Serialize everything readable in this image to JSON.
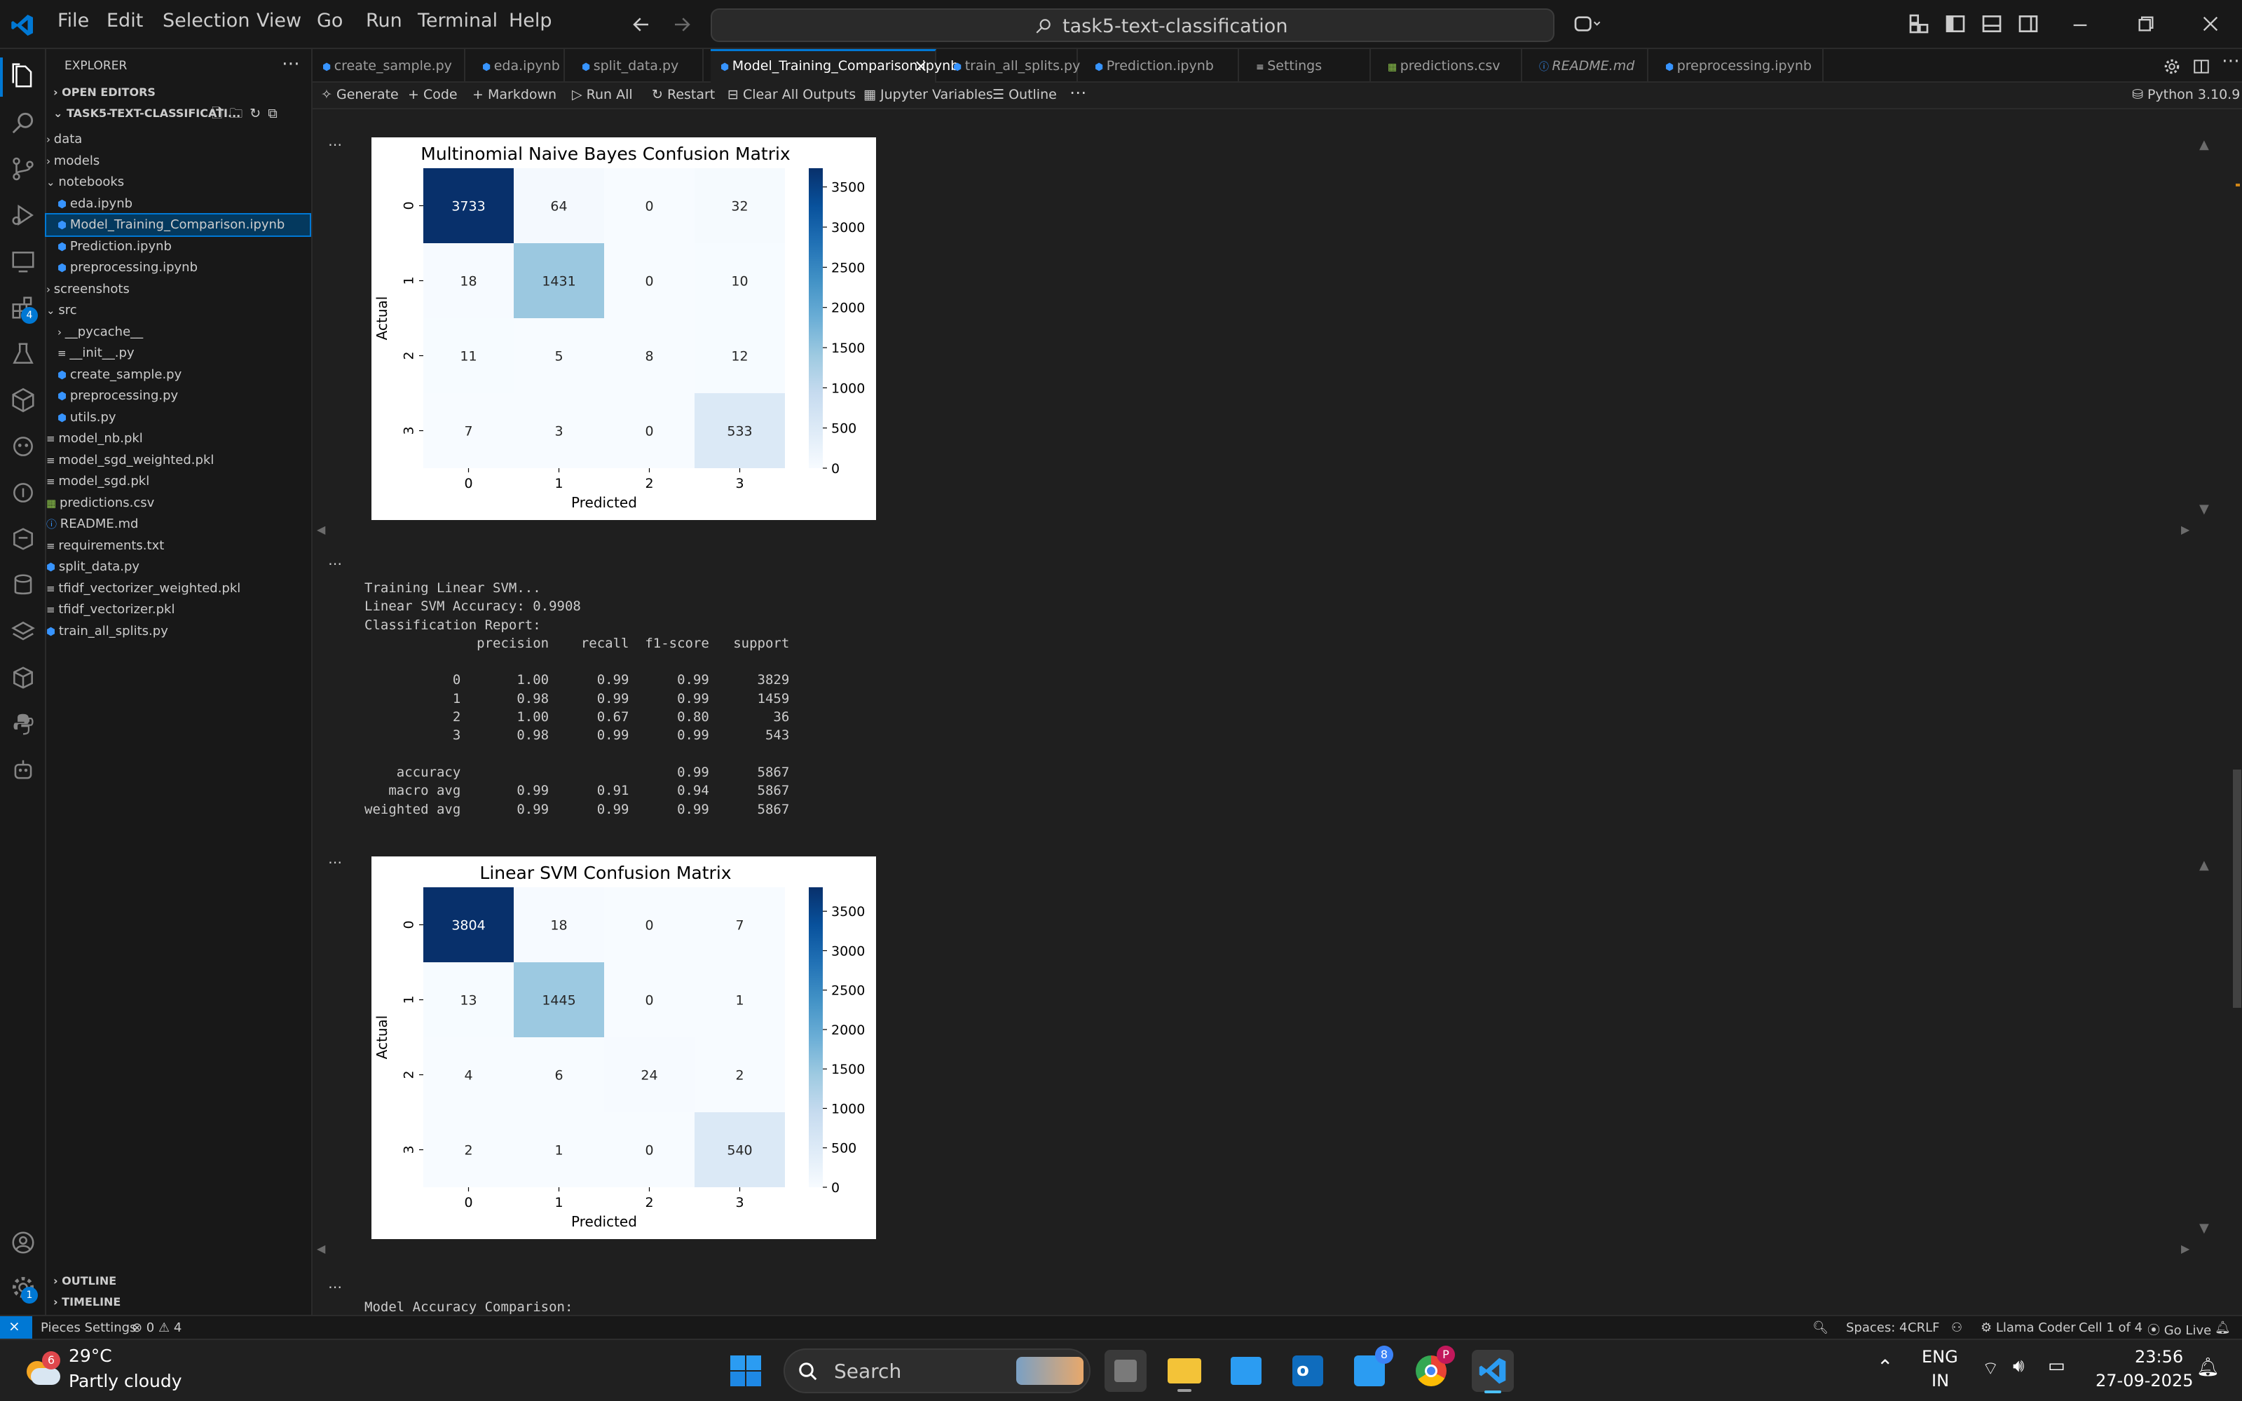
{
  "menu": [
    "File",
    "Edit",
    "Selection",
    "View",
    "Go",
    "Run",
    "Terminal",
    "Help"
  ],
  "command_center": "task5-text-classification",
  "explorer": {
    "title": "EXPLORER",
    "open_editors": "OPEN EDITORS",
    "project": "TASK5-TEXT-CLASSIFICATI...",
    "items": [
      {
        "label": "data",
        "kind": "folder"
      },
      {
        "label": "models",
        "kind": "folder"
      },
      {
        "label": "notebooks",
        "kind": "folder-open"
      },
      {
        "label": "eda.ipynb",
        "kind": "notebook"
      },
      {
        "label": "Model_Training_Comparison.ipynb",
        "kind": "notebook",
        "selected": true
      },
      {
        "label": "Prediction.ipynb",
        "kind": "notebook"
      },
      {
        "label": "preprocessing.ipynb",
        "kind": "notebook"
      },
      {
        "label": "screenshots",
        "kind": "folder"
      },
      {
        "label": "src",
        "kind": "folder-open"
      },
      {
        "label": "__pycache__",
        "kind": "folder"
      },
      {
        "label": "__init__.py",
        "kind": "file"
      },
      {
        "label": "create_sample.py",
        "kind": "python"
      },
      {
        "label": "preprocessing.py",
        "kind": "python"
      },
      {
        "label": "utils.py",
        "kind": "python"
      },
      {
        "label": "model_nb.pkl",
        "kind": "file"
      },
      {
        "label": "model_sgd_weighted.pkl",
        "kind": "file"
      },
      {
        "label": "model_sgd.pkl",
        "kind": "file"
      },
      {
        "label": "predictions.csv",
        "kind": "csv"
      },
      {
        "label": "README.md",
        "kind": "info"
      },
      {
        "label": "requirements.txt",
        "kind": "file"
      },
      {
        "label": "split_data.py",
        "kind": "python"
      },
      {
        "label": "tfidf_vectorizer_weighted.pkl",
        "kind": "file"
      },
      {
        "label": "tfidf_vectorizer.pkl",
        "kind": "file"
      },
      {
        "label": "train_all_splits.py",
        "kind": "python"
      }
    ],
    "outline": "OUTLINE",
    "timeline": "TIMELINE"
  },
  "tabs": [
    {
      "label": "create_sample.py",
      "active": false
    },
    {
      "label": "eda.ipynb",
      "active": false
    },
    {
      "label": "split_data.py",
      "active": false
    },
    {
      "label": "Model_Training_Comparison.ipynb",
      "active": true
    },
    {
      "label": "train_all_splits.py",
      "active": false
    },
    {
      "label": "Prediction.ipynb",
      "active": false
    },
    {
      "label": "Settings",
      "active": false
    },
    {
      "label": "predictions.csv",
      "active": false
    },
    {
      "label": "README.md",
      "active": false
    },
    {
      "label": "preprocessing.ipynb",
      "active": false
    }
  ],
  "toolbar": {
    "generate": "Generate",
    "code": "Code",
    "markdown": "Markdown",
    "run_all": "Run All",
    "restart": "Restart",
    "clear": "Clear All Outputs",
    "variables": "Jupyter Variables",
    "outline": "Outline",
    "kernel": "Python 3.10.9"
  },
  "plots": [
    {
      "title": "Multinomial Naive Bayes Confusion Matrix",
      "xlabel": "Predicted",
      "ylabel": "Actual",
      "labels": [
        "0",
        "1",
        "2",
        "3"
      ],
      "matrix": [
        [
          3733,
          64,
          0,
          32
        ],
        [
          18,
          1431,
          0,
          10
        ],
        [
          11,
          5,
          8,
          12
        ],
        [
          7,
          3,
          0,
          533
        ]
      ],
      "colorbar_ticks": [
        "3500",
        "3000",
        "2500",
        "2000",
        "1500",
        "1000",
        "500",
        "0"
      ]
    },
    {
      "title": "Linear SVM Confusion Matrix",
      "xlabel": "Predicted",
      "ylabel": "Actual",
      "labels": [
        "0",
        "1",
        "2",
        "3"
      ],
      "matrix": [
        [
          3804,
          18,
          0,
          7
        ],
        [
          13,
          1445,
          0,
          1
        ],
        [
          4,
          6,
          24,
          2
        ],
        [
          2,
          1,
          0,
          540
        ]
      ],
      "colorbar_ticks": [
        "3500",
        "3000",
        "2500",
        "2000",
        "1500",
        "1000",
        "500",
        "0"
      ]
    }
  ],
  "svm_output": "Training Linear SVM...\nLinear SVM Accuracy: 0.9908\nClassification Report:\n              precision    recall  f1-score   support\n\n           0       1.00      0.99      0.99      3829\n           1       0.98      0.99      0.99      1459\n           2       1.00      0.67      0.80        36\n           3       0.98      0.99      0.99       543\n\n    accuracy                           0.99      5867\n   macro avg       0.99      0.91      0.94      5867\nweighted avg       0.99      0.99      0.99      5867",
  "comparison_text": "Model Accuracy Comparison:",
  "status": {
    "pieces": "Pieces Settings",
    "problems": "⊗ 0 ⚠ 4",
    "spaces": "Spaces: 4",
    "eol": "CRLF",
    "llama": "Llama Coder",
    "cell": "Cell 1 of 4",
    "golive": "Go Live"
  },
  "taskbar": {
    "temp": "29°C",
    "weather": "Partly cloudy",
    "weather_badge": "6",
    "search": "Search",
    "lang1": "ENG",
    "lang2": "IN",
    "time": "23:56",
    "date": "27-09-2025"
  },
  "activity_badges": {
    "extensions": "4",
    "accounts": "1"
  }
}
